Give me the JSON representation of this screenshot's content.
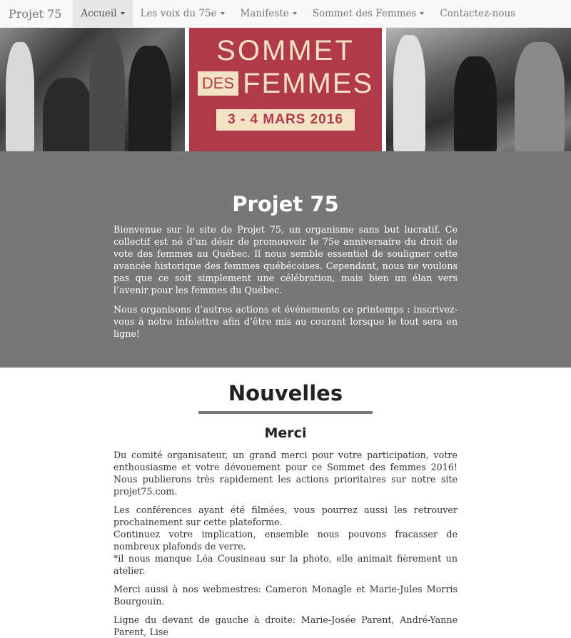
{
  "navbar": {
    "brand": "Projet 75",
    "items": [
      {
        "label": "Accueil",
        "dropdown": true,
        "active": true
      },
      {
        "label": "Les voix du 75e",
        "dropdown": true
      },
      {
        "label": "Manifeste",
        "dropdown": true
      },
      {
        "label": "Sommet des Femmes",
        "dropdown": true
      },
      {
        "label": "Contactez-nous",
        "dropdown": false
      }
    ]
  },
  "banner": {
    "poster_line1": "SOMMET",
    "poster_des": "DES",
    "poster_femmes": "FEMMES",
    "poster_date": "3 - 4 MARS 2016",
    "poster_color": "#b03a4a",
    "poster_text_color": "#f3e3c4"
  },
  "hero": {
    "title": "Projet 75",
    "paragraphs": [
      "Bienvenue sur le site de Projet 75, un organisme sans but lucratif. Ce collectif est né d’un désir de promouvoir le 75e anniversaire du droit de vote des femmes au Québec. Il nous semble essentiel de souligner cette avancée historique des femmes québécoises. Cependant, nous ne voulons pas que ce soit simplement une célébration, mais bien un élan vers l’avenir pour les femmes du Québec.",
      "Nous organisons d’autres actions et événements ce printemps : inscrivez-vous à notre infolettre afin d’être mis au courant lorsque le tout sera en ligne!"
    ],
    "background": "#777777"
  },
  "news": {
    "title": "Nouvelles",
    "article_title": "Merci",
    "p1": "Du comité organisateur, un grand merci pour votre participation, votre enthousiasme et votre dévouement pour ce Sommet des femmes 2016! Nous publierons très rapidement les actions prioritaires sur notre site projet75.com.",
    "p2_line1": "Les conférences ayant été filmées, vous pourrez aussi les retrouver prochainement sur cette plateforme.",
    "p2_line2": "Continuez votre implication, ensemble nous pouvons fracasser de nombreux plafonds de verre.",
    "p2_line3": "*il nous manque Léa Cousineau sur la photo, elle animait fièrement un atelier.",
    "p3": "Merci aussi à nos webmestres: Cameron Monagle et Marie-Jules Morris Bourgouin.",
    "p4": "Ligne du devant de gauche à droite: Marie-Josée Parent, André-Yanne Parent, Lise"
  }
}
